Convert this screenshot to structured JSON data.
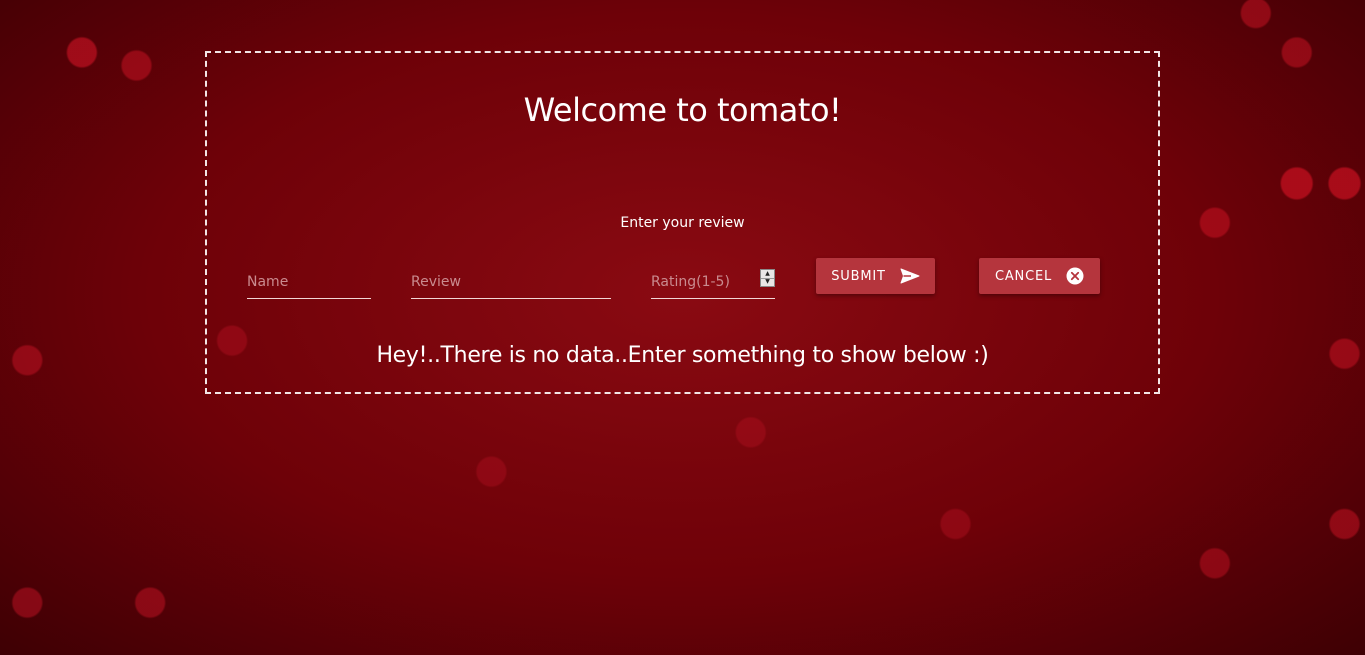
{
  "page": {
    "title": "Welcome to tomato!",
    "subtitle": "Enter your review",
    "empty_message": "Hey!..There is no data..Enter something to show below :)"
  },
  "form": {
    "name_placeholder": "Name",
    "review_placeholder": "Review",
    "rating_placeholder": "Rating(1-5)",
    "submit_label": "SUBMIT",
    "submit_icon": "send-icon",
    "cancel_label": "CANCEL",
    "cancel_icon": "close-circle-icon"
  },
  "colors": {
    "background": "#7a0008",
    "button": "#b5353d",
    "text": "#ffffff",
    "panel_border": "#f3e6e6"
  }
}
